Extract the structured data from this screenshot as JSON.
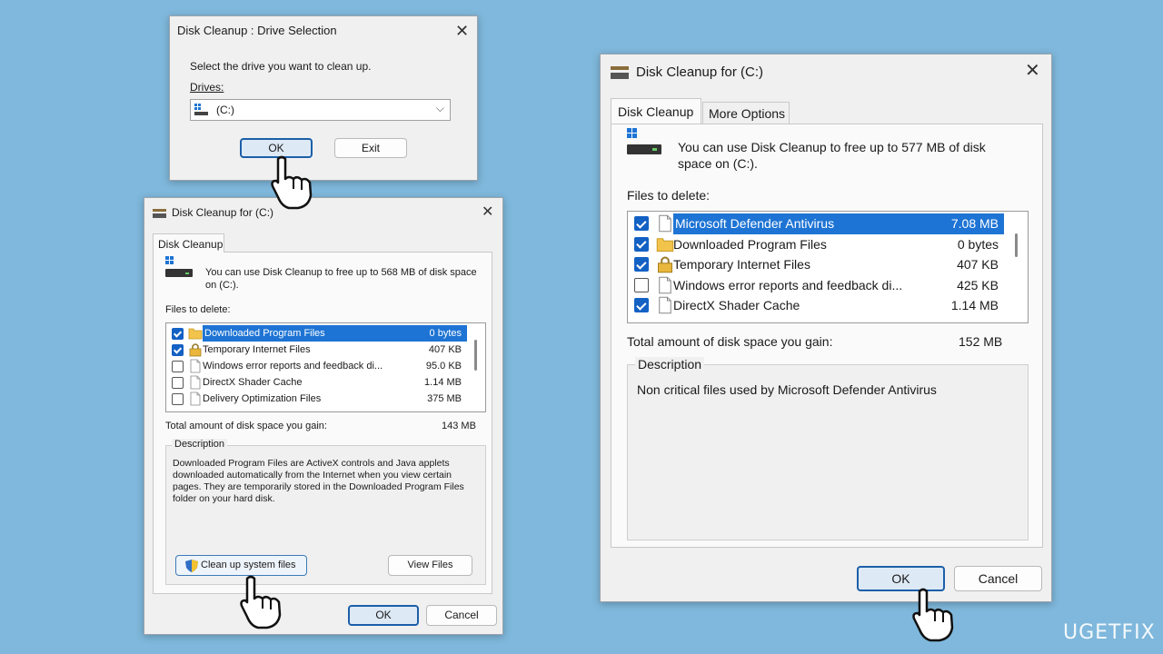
{
  "drive_selection": {
    "title": "Disk Cleanup : Drive Selection",
    "prompt": "Select the drive you want to clean up.",
    "drives_label": "Drives:",
    "selected_drive": "(C:)",
    "ok_label": "OK",
    "exit_label": "Exit"
  },
  "cleanup_small": {
    "title": "Disk Cleanup for  (C:)",
    "tab": "Disk Cleanup",
    "info": "You can use Disk Cleanup to free up to 568 MB of disk space on  (C:).",
    "files_label": "Files to delete:",
    "files": [
      {
        "name": "Downloaded Program Files",
        "size": "0 bytes",
        "checked": true,
        "selected": true,
        "icon": "folder-icon"
      },
      {
        "name": "Temporary Internet Files",
        "size": "407 KB",
        "checked": true,
        "selected": false,
        "icon": "lock-icon"
      },
      {
        "name": "Windows error reports and feedback di...",
        "size": "95.0 KB",
        "checked": false,
        "selected": false,
        "icon": "file-icon"
      },
      {
        "name": "DirectX Shader Cache",
        "size": "1.14 MB",
        "checked": false,
        "selected": false,
        "icon": "file-icon"
      },
      {
        "name": "Delivery Optimization Files",
        "size": "375 MB",
        "checked": false,
        "selected": false,
        "icon": "file-icon"
      }
    ],
    "total_label": "Total amount of disk space you gain:",
    "total_value": "143 MB",
    "description_title": "Description",
    "description": "Downloaded Program Files are ActiveX controls and Java applets downloaded automatically from the Internet when you view certain pages. They are temporarily stored in the Downloaded Program Files folder on your hard disk.",
    "cleanup_system_label": "Clean up system files",
    "view_files_label": "View Files",
    "ok_label": "OK",
    "cancel_label": "Cancel"
  },
  "cleanup_large": {
    "title": "Disk Cleanup for  (C:)",
    "tabs": [
      "Disk Cleanup",
      "More Options"
    ],
    "info": "You can use Disk Cleanup to free up to 577 MB of disk space on  (C:).",
    "files_label": "Files to delete:",
    "files": [
      {
        "name": "Microsoft Defender Antivirus",
        "size": "7.08 MB",
        "checked": true,
        "selected": true,
        "icon": "file-icon"
      },
      {
        "name": "Downloaded Program Files",
        "size": "0 bytes",
        "checked": true,
        "selected": false,
        "icon": "folder-icon"
      },
      {
        "name": "Temporary Internet Files",
        "size": "407 KB",
        "checked": true,
        "selected": false,
        "icon": "lock-icon"
      },
      {
        "name": "Windows error reports and feedback di...",
        "size": "425 KB",
        "checked": false,
        "selected": false,
        "icon": "file-icon"
      },
      {
        "name": "DirectX Shader Cache",
        "size": "1.14 MB",
        "checked": true,
        "selected": false,
        "icon": "file-icon"
      }
    ],
    "total_label": "Total amount of disk space you gain:",
    "total_value": "152 MB",
    "description_title": "Description",
    "description": "Non critical files used by Microsoft Defender Antivirus",
    "ok_label": "OK",
    "cancel_label": "Cancel"
  },
  "watermark": "UGETFIX",
  "colors": {
    "background": "#7fb8dc",
    "selection": "#1e74d4",
    "checkbox": "#1461c4"
  }
}
